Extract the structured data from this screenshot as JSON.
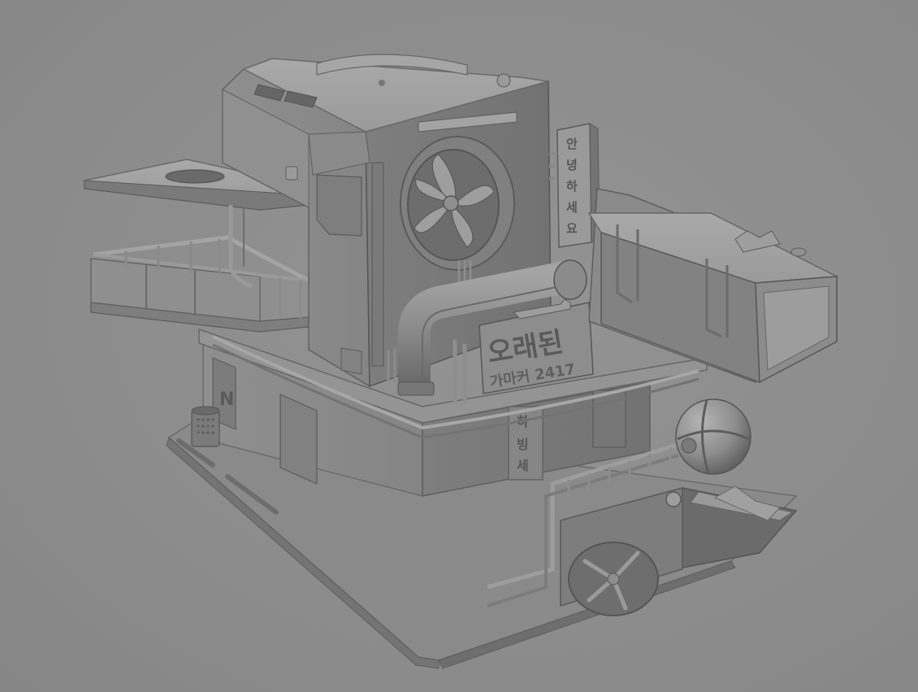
{
  "scene": {
    "background_color": "#8e8e8e",
    "model_base_color": "#8a8a8a",
    "light_color": "#a6a6a6",
    "shadow_color": "#5e5e5e"
  },
  "signs": {
    "main_sign_title": "오래된",
    "main_sign_sub": "가마커 2417",
    "vertical_sign_chars": [
      "안",
      "녕",
      "하",
      "세",
      "요"
    ],
    "lower_sign_chars": [
      "하",
      "빙",
      "세"
    ],
    "door_letter": "N"
  }
}
